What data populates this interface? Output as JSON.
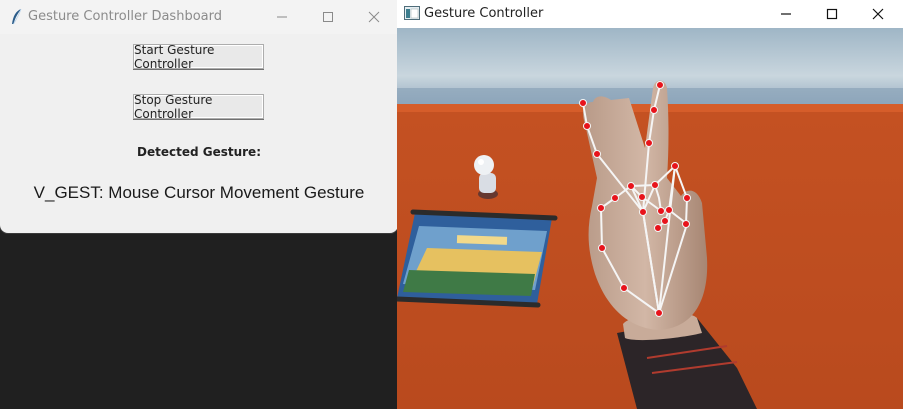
{
  "dashboard": {
    "title": "Gesture Controller Dashboard",
    "start_button": "Start Gesture Controller",
    "stop_button": "Stop Gesture Controller",
    "detected_label": "Detected Gesture:",
    "detected_value": "V_GEST: Mouse Cursor Movement Gesture"
  },
  "camera_window": {
    "title": "Gesture Controller"
  },
  "colors": {
    "landmark": "#e8131b",
    "connection": "#f5f5f5",
    "wall": "#c95325"
  },
  "icons": [
    "feather-icon",
    "minimize-icon",
    "maximize-icon",
    "close-icon",
    "app-window-icon"
  ]
}
